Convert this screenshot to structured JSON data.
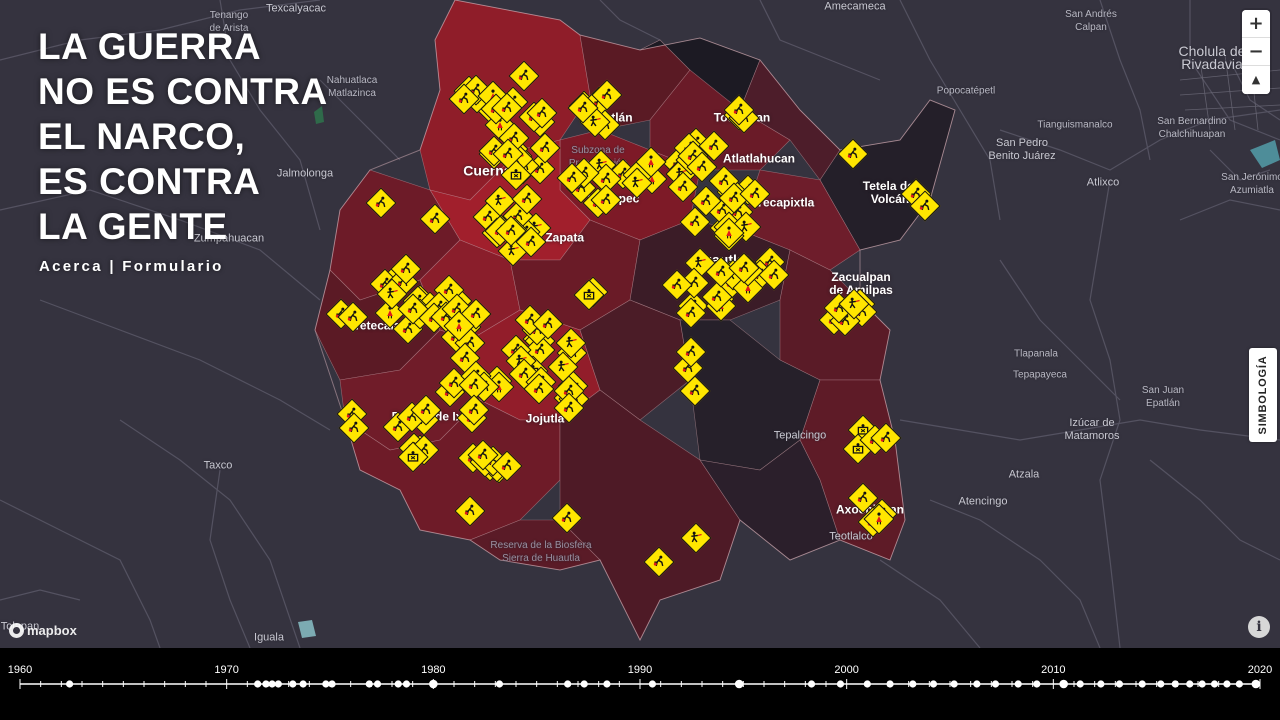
{
  "title": "LA GUERRA\nNO ES CONTRA\nEL NARCO,\nES CONTRA\nLA GENTE",
  "nav": {
    "about": "Acerca",
    "separator": "|",
    "form": "Formulario"
  },
  "legend_button": "SIMBOLOGÍA",
  "map_controls": {
    "zoom_in": "+",
    "zoom_out": "−",
    "compass": "▲"
  },
  "attribution": {
    "logo": "mapbox",
    "info": "i"
  },
  "places": [
    {
      "name": "Tenango\nde Arista",
      "kind": "small"
    },
    {
      "name": "Texcalyacac",
      "kind": "normal"
    },
    {
      "name": "Amecameca",
      "kind": "normal"
    },
    {
      "name": "San Andrés\nCalpan",
      "kind": "small"
    },
    {
      "name": "Cholula de\nRivadavia",
      "kind": "big"
    },
    {
      "name": "Nahuatlaca\nMatlazinca",
      "kind": "small"
    },
    {
      "name": "Popocatépetl",
      "kind": "small"
    },
    {
      "name": "Tianguismanalco",
      "kind": "small"
    },
    {
      "name": "San Bernardino\nChalchihuapan",
      "kind": "small"
    },
    {
      "name": "San Pedro\nBenito Juárez",
      "kind": "normal"
    },
    {
      "name": "Jalmolonga",
      "kind": "normal"
    },
    {
      "name": "Atlixco",
      "kind": "normal"
    },
    {
      "name": "San Jerónimo\nAzumiatla",
      "kind": "small"
    },
    {
      "name": "Zumpahuacan",
      "kind": "normal"
    },
    {
      "name": "Taxco",
      "kind": "normal"
    },
    {
      "name": "Tlapanala",
      "kind": "small"
    },
    {
      "name": "Tepapayeca",
      "kind": "small"
    },
    {
      "name": "San Juan\nEpatlán",
      "kind": "small"
    },
    {
      "name": "Izúcar de\nMatamoros",
      "kind": "normal"
    },
    {
      "name": "Atzala",
      "kind": "normal"
    },
    {
      "name": "Atencingo",
      "kind": "normal"
    },
    {
      "name": "Tolapan",
      "kind": "normal"
    },
    {
      "name": "Iguala",
      "kind": "normal"
    },
    {
      "name": "Teotlalco",
      "kind": "normal"
    },
    {
      "name": "Tepalcingo",
      "kind": "normal"
    },
    {
      "name": "Tepoztlán",
      "kind": "city"
    },
    {
      "name": "Totolapan",
      "kind": "city"
    },
    {
      "name": "Subzona de\nPreservación",
      "kind": "park"
    },
    {
      "name": "Cuernavaca",
      "kind": "city big"
    },
    {
      "name": "Atlatlahucan",
      "kind": "city"
    },
    {
      "name": "Yautepec",
      "kind": "city"
    },
    {
      "name": "Yecapixtla",
      "kind": "city"
    },
    {
      "name": "Tetela del\nVolcán",
      "kind": "city"
    },
    {
      "name": "Emiliano Zapata",
      "kind": "city"
    },
    {
      "name": "Cuautla",
      "kind": "city big"
    },
    {
      "name": "Zacualpan\nde Amilpas",
      "kind": "city"
    },
    {
      "name": "Tetecala",
      "kind": "city"
    },
    {
      "name": "Puente de Ixtla",
      "kind": "city"
    },
    {
      "name": "Jojutla",
      "kind": "city"
    },
    {
      "name": "Axochiapan",
      "kind": "city"
    },
    {
      "name": "Reserva de la Biosfera\nSierra de Huautla",
      "kind": "park"
    }
  ],
  "timeline": {
    "start": 1960,
    "end": 2020,
    "tick_labels": [
      "1960",
      "1970",
      "1980",
      "1990",
      "2000",
      "2010",
      "2020"
    ],
    "event_years": [
      1962.4,
      1971.5,
      1971.9,
      1972.2,
      1972.5,
      1973.2,
      1973.7,
      1974.8,
      1975.1,
      1976.9,
      1977.3,
      1978.3,
      1978.7,
      1980.0,
      1983.2,
      1986.5,
      1987.3,
      1988.4,
      1990.6,
      1994.8,
      1998.3,
      1999.7,
      2001.0,
      2002.1,
      2003.2,
      2004.2,
      2005.2,
      2006.3,
      2007.2,
      2008.3,
      2009.2,
      2010.5,
      2011.3,
      2012.3,
      2013.2,
      2014.3,
      2015.2,
      2015.9,
      2016.6,
      2017.2,
      2017.8,
      2018.4,
      2019.0,
      2019.8
    ],
    "major_years": [
      1980.0,
      1994.8,
      2010.5,
      2019.8
    ]
  },
  "colors": {
    "background": "#35333f",
    "sign_fill": "#ffe600",
    "timeline_bg": "#000000",
    "timeline_line": "#ffffff"
  }
}
